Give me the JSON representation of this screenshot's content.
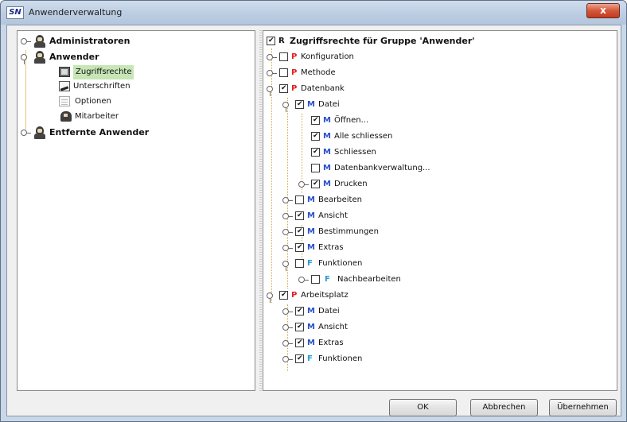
{
  "window": {
    "app_icon": "SN",
    "title": "Anwenderverwaltung",
    "close_label": "x"
  },
  "left_tree": {
    "administratoren": "Administratoren",
    "anwender": "Anwender",
    "zugriffsrechte": "Zugriffsrechte",
    "unterschriften": "Unterschriften",
    "optionen": "Optionen",
    "mitarbeiter": "Mitarbeiter",
    "entfernte_anwender": "Entfernte Anwender"
  },
  "right_tree": {
    "root": {
      "letter": "R",
      "label": "Zugriffsrechte für Gruppe 'Anwender'",
      "checked": true
    },
    "items": [
      {
        "letter": "P",
        "label": "Konfiguration",
        "checked": false
      },
      {
        "letter": "P",
        "label": "Methode",
        "checked": false
      },
      {
        "letter": "P",
        "label": "Datenbank",
        "checked": true
      },
      {
        "letter": "M",
        "label": "Datei",
        "checked": true
      },
      {
        "letter": "M",
        "label": "Öffnen...",
        "checked": true
      },
      {
        "letter": "M",
        "label": "Alle schliessen",
        "checked": true
      },
      {
        "letter": "M",
        "label": "Schliessen",
        "checked": true
      },
      {
        "letter": "M",
        "label": "Datenbankverwaltung...",
        "checked": false
      },
      {
        "letter": "M",
        "label": "Drucken",
        "checked": true
      },
      {
        "letter": "M",
        "label": "Bearbeiten",
        "checked": false
      },
      {
        "letter": "M",
        "label": "Ansicht",
        "checked": true
      },
      {
        "letter": "M",
        "label": "Bestimmungen",
        "checked": true
      },
      {
        "letter": "M",
        "label": "Extras",
        "checked": true
      },
      {
        "letter": "F",
        "label": "Funktionen",
        "checked": false
      },
      {
        "letter": "F",
        "label": "Nachbearbeiten",
        "checked": false
      },
      {
        "letter": "P",
        "label": "Arbeitsplatz",
        "checked": true
      },
      {
        "letter": "M",
        "label": "Datei",
        "checked": true
      },
      {
        "letter": "M",
        "label": "Ansicht",
        "checked": true
      },
      {
        "letter": "M",
        "label": "Extras",
        "checked": true
      },
      {
        "letter": "F",
        "label": "Funktionen",
        "checked": true
      }
    ]
  },
  "buttons": {
    "ok": "OK",
    "cancel": "Abbrechen",
    "apply": "Übernehmen"
  },
  "colors": {
    "letter_P": "#e02020",
    "letter_M": "#2a50c8",
    "letter_F": "#2a9ad8",
    "selection": "#c7e6b6"
  }
}
